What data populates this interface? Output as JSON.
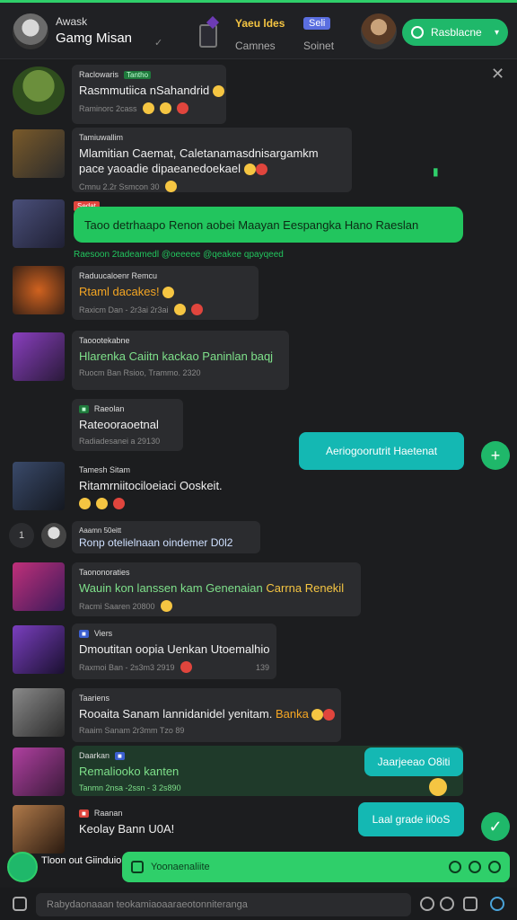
{
  "header": {
    "title": "Awask",
    "name": "Gamg Misan",
    "tab1_label": "Yaeu ldes",
    "tab1_badge": "Seli",
    "tab1_sub": "Camnes",
    "tab2_sub": "Soinet",
    "action_button": "Rasblacne",
    "accent": "#1fb86a"
  },
  "messages": [
    {
      "name": "Raclowaris",
      "tag": "Tantho",
      "text": "Rasmmutiica nSahandrid",
      "meta": "Raminorc 2cass"
    },
    {
      "name": "Tamiuwallim",
      "text": "Mlamitian Caemat, Caletanamasdnisargamkm",
      "text2": "pace yaoadie dipaeanedoekael",
      "meta": "Cmnu 2.2r Ssmcon 30"
    },
    {
      "tag": "Sedat",
      "text": "Taoo detrhaapo Renon aobei Maayan Eespangka Hano Raeslan",
      "caption": "Raesoon 2tadeamedl @oeeeee @qeakee qpayqeed"
    },
    {
      "name": "Raduucaloenr Remcu",
      "text": "Rtaml dacakes!",
      "meta": "Raxicm Dan - 2r3ai 2r3ai"
    },
    {
      "name": "Taoootekabne",
      "text": "Hlarenka Caiitn kackao Paninlan baqj",
      "meta": "Ruocm Ban Rsioo, Trammo. 2320"
    },
    {
      "name": "Raeolan",
      "text": "Rateooraoetnal",
      "meta": "Radiadesanei a 29130"
    },
    {
      "text": "Aeriogoorutrit Haetenat"
    },
    {
      "name": "Tamesh Sitam",
      "text": "Ritamrniitociloeiaci Ooskeit."
    },
    {
      "name": "Aaamn 50eitt",
      "text": "Ronp otelielnaan oindemer D0l2",
      "count": "1"
    },
    {
      "name": "Taononoraties",
      "text": "Wauin kon lanssen kam Genenaian",
      "highlight": "Carrna Renekil",
      "meta": "Racmi Saaren 20800"
    },
    {
      "name": "Viers",
      "text": "Dmoutitan oopia Uenkan Utoemalhio",
      "meta": "Raxmoi Ban - 2s3m3 2919",
      "count": "139"
    },
    {
      "name": "Taariens",
      "text": "Rooaita Sanam lannidanidel yenitam.",
      "highlight": "Banka",
      "meta": "Raaim Sanam 2r3mm Tzo 89"
    },
    {
      "name": "Daarkan",
      "text": "Remaliooko kanten",
      "meta": "Tanmn 2nsa -2ssn - 3 2s890"
    },
    {
      "text": "Jaarjeeao O8iti"
    },
    {
      "name": "Raanan",
      "text": "Keolay Bann U0A!"
    },
    {
      "text": "Laal grade ii0oS"
    }
  ],
  "compose": {
    "label": "Tloon out Giinduio",
    "placeholder": "Yoonaenaliite"
  },
  "bottom": {
    "placeholder": "Rabydaonaaan teokamiaoaaraeotonniteranga"
  }
}
